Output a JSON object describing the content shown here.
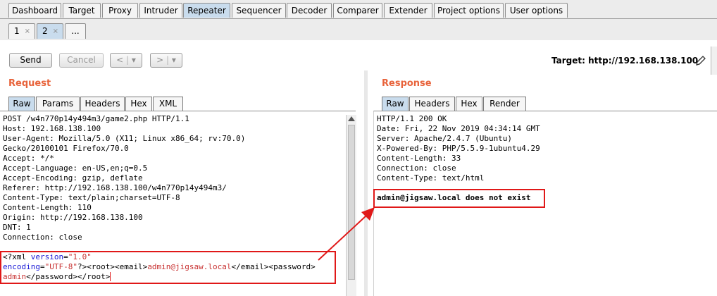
{
  "top_tabs": [
    "Dashboard",
    "Target",
    "Proxy",
    "Intruder",
    "Repeater",
    "Sequencer",
    "Decoder",
    "Comparer",
    "Extender",
    "Project options",
    "User options"
  ],
  "active_top_tab": "Repeater",
  "sub_tabs": [
    {
      "label": "1",
      "close": "×"
    },
    {
      "label": "2",
      "close": "×"
    },
    {
      "label": "..."
    }
  ],
  "toolbar": {
    "send": "Send",
    "cancel": "Cancel",
    "back": "<",
    "forward": ">",
    "dropdown": "▾",
    "target_label": "Target: http://192.168.138.100"
  },
  "request": {
    "title": "Request",
    "tabs": [
      "Raw",
      "Params",
      "Headers",
      "Hex",
      "XML"
    ],
    "headers": [
      "POST /w4n770p14y494m3/game2.php HTTP/1.1",
      "Host: 192.168.138.100",
      "User-Agent: Mozilla/5.0 (X11; Linux x86_64; rv:70.0)",
      "Gecko/20100101 Firefox/70.0",
      "Accept: */*",
      "Accept-Language: en-US,en;q=0.5",
      "Accept-Encoding: gzip, deflate",
      "Referer: http://192.168.138.100/w4n770p14y494m3/",
      "Content-Type: text/plain;charset=UTF-8",
      "Content-Length: 110",
      "Origin: http://192.168.138.100",
      "DNT: 1",
      "Connection: close"
    ],
    "body": {
      "l1_tag": "<?xml ",
      "l1_attr": "version",
      "l1_eq": "=",
      "l1_val": "\"1.0\"",
      "l2_attr": "encoding",
      "l2_eq": "=",
      "l2_val": "\"UTF-8\"",
      "l2_rest1": "?><root><email>",
      "l2_email": "admin@jigsaw.local",
      "l2_rest2": "</email><password>",
      "l3_pw": "admin",
      "l3_rest": "</password></root>"
    }
  },
  "response": {
    "title": "Response",
    "tabs": [
      "Raw",
      "Headers",
      "Hex",
      "Render"
    ],
    "headers": [
      "HTTP/1.1 200 OK",
      "Date: Fri, 22 Nov 2019 04:34:14 GMT",
      "Server: Apache/2.4.7 (Ubuntu)",
      "X-Powered-By: PHP/5.5.9-1ubuntu4.29",
      "Content-Length: 33",
      "Connection: close",
      "Content-Type: text/html"
    ],
    "body": "admin@jigsaw.local does not exist"
  },
  "colors": {
    "accent_title": "#e8643c",
    "highlight_red": "#e01818",
    "active_tab": "#c9dced"
  },
  "icons": {
    "edit": "pencil-icon"
  }
}
